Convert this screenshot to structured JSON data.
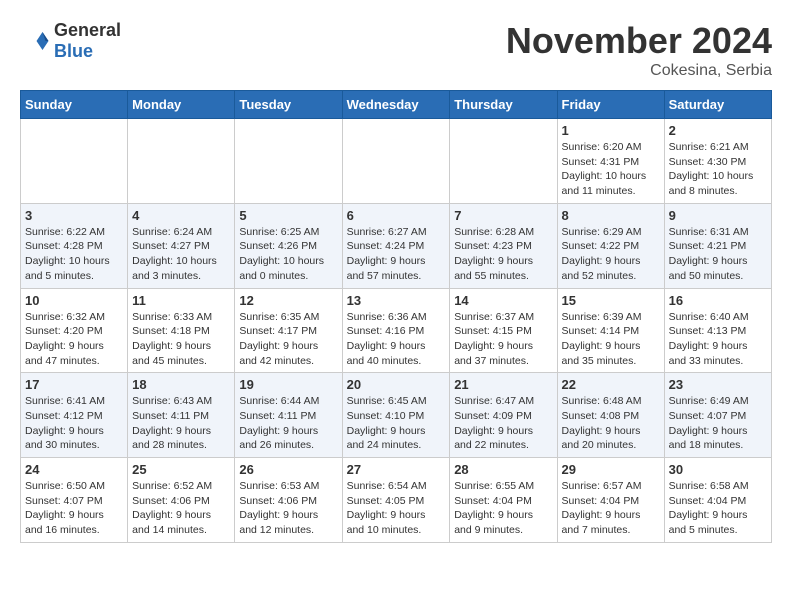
{
  "header": {
    "logo": {
      "general": "General",
      "blue": "Blue"
    },
    "title": "November 2024",
    "location": "Cokesina, Serbia"
  },
  "weekdays": [
    "Sunday",
    "Monday",
    "Tuesday",
    "Wednesday",
    "Thursday",
    "Friday",
    "Saturday"
  ],
  "weeks": [
    [
      {
        "day": "",
        "info": ""
      },
      {
        "day": "",
        "info": ""
      },
      {
        "day": "",
        "info": ""
      },
      {
        "day": "",
        "info": ""
      },
      {
        "day": "",
        "info": ""
      },
      {
        "day": "1",
        "info": "Sunrise: 6:20 AM\nSunset: 4:31 PM\nDaylight: 10 hours and 11 minutes."
      },
      {
        "day": "2",
        "info": "Sunrise: 6:21 AM\nSunset: 4:30 PM\nDaylight: 10 hours and 8 minutes."
      }
    ],
    [
      {
        "day": "3",
        "info": "Sunrise: 6:22 AM\nSunset: 4:28 PM\nDaylight: 10 hours and 5 minutes."
      },
      {
        "day": "4",
        "info": "Sunrise: 6:24 AM\nSunset: 4:27 PM\nDaylight: 10 hours and 3 minutes."
      },
      {
        "day": "5",
        "info": "Sunrise: 6:25 AM\nSunset: 4:26 PM\nDaylight: 10 hours and 0 minutes."
      },
      {
        "day": "6",
        "info": "Sunrise: 6:27 AM\nSunset: 4:24 PM\nDaylight: 9 hours and 57 minutes."
      },
      {
        "day": "7",
        "info": "Sunrise: 6:28 AM\nSunset: 4:23 PM\nDaylight: 9 hours and 55 minutes."
      },
      {
        "day": "8",
        "info": "Sunrise: 6:29 AM\nSunset: 4:22 PM\nDaylight: 9 hours and 52 minutes."
      },
      {
        "day": "9",
        "info": "Sunrise: 6:31 AM\nSunset: 4:21 PM\nDaylight: 9 hours and 50 minutes."
      }
    ],
    [
      {
        "day": "10",
        "info": "Sunrise: 6:32 AM\nSunset: 4:20 PM\nDaylight: 9 hours and 47 minutes."
      },
      {
        "day": "11",
        "info": "Sunrise: 6:33 AM\nSunset: 4:18 PM\nDaylight: 9 hours and 45 minutes."
      },
      {
        "day": "12",
        "info": "Sunrise: 6:35 AM\nSunset: 4:17 PM\nDaylight: 9 hours and 42 minutes."
      },
      {
        "day": "13",
        "info": "Sunrise: 6:36 AM\nSunset: 4:16 PM\nDaylight: 9 hours and 40 minutes."
      },
      {
        "day": "14",
        "info": "Sunrise: 6:37 AM\nSunset: 4:15 PM\nDaylight: 9 hours and 37 minutes."
      },
      {
        "day": "15",
        "info": "Sunrise: 6:39 AM\nSunset: 4:14 PM\nDaylight: 9 hours and 35 minutes."
      },
      {
        "day": "16",
        "info": "Sunrise: 6:40 AM\nSunset: 4:13 PM\nDaylight: 9 hours and 33 minutes."
      }
    ],
    [
      {
        "day": "17",
        "info": "Sunrise: 6:41 AM\nSunset: 4:12 PM\nDaylight: 9 hours and 30 minutes."
      },
      {
        "day": "18",
        "info": "Sunrise: 6:43 AM\nSunset: 4:11 PM\nDaylight: 9 hours and 28 minutes."
      },
      {
        "day": "19",
        "info": "Sunrise: 6:44 AM\nSunset: 4:11 PM\nDaylight: 9 hours and 26 minutes."
      },
      {
        "day": "20",
        "info": "Sunrise: 6:45 AM\nSunset: 4:10 PM\nDaylight: 9 hours and 24 minutes."
      },
      {
        "day": "21",
        "info": "Sunrise: 6:47 AM\nSunset: 4:09 PM\nDaylight: 9 hours and 22 minutes."
      },
      {
        "day": "22",
        "info": "Sunrise: 6:48 AM\nSunset: 4:08 PM\nDaylight: 9 hours and 20 minutes."
      },
      {
        "day": "23",
        "info": "Sunrise: 6:49 AM\nSunset: 4:07 PM\nDaylight: 9 hours and 18 minutes."
      }
    ],
    [
      {
        "day": "24",
        "info": "Sunrise: 6:50 AM\nSunset: 4:07 PM\nDaylight: 9 hours and 16 minutes."
      },
      {
        "day": "25",
        "info": "Sunrise: 6:52 AM\nSunset: 4:06 PM\nDaylight: 9 hours and 14 minutes."
      },
      {
        "day": "26",
        "info": "Sunrise: 6:53 AM\nSunset: 4:06 PM\nDaylight: 9 hours and 12 minutes."
      },
      {
        "day": "27",
        "info": "Sunrise: 6:54 AM\nSunset: 4:05 PM\nDaylight: 9 hours and 10 minutes."
      },
      {
        "day": "28",
        "info": "Sunrise: 6:55 AM\nSunset: 4:04 PM\nDaylight: 9 hours and 9 minutes."
      },
      {
        "day": "29",
        "info": "Sunrise: 6:57 AM\nSunset: 4:04 PM\nDaylight: 9 hours and 7 minutes."
      },
      {
        "day": "30",
        "info": "Sunrise: 6:58 AM\nSunset: 4:04 PM\nDaylight: 9 hours and 5 minutes."
      }
    ]
  ]
}
